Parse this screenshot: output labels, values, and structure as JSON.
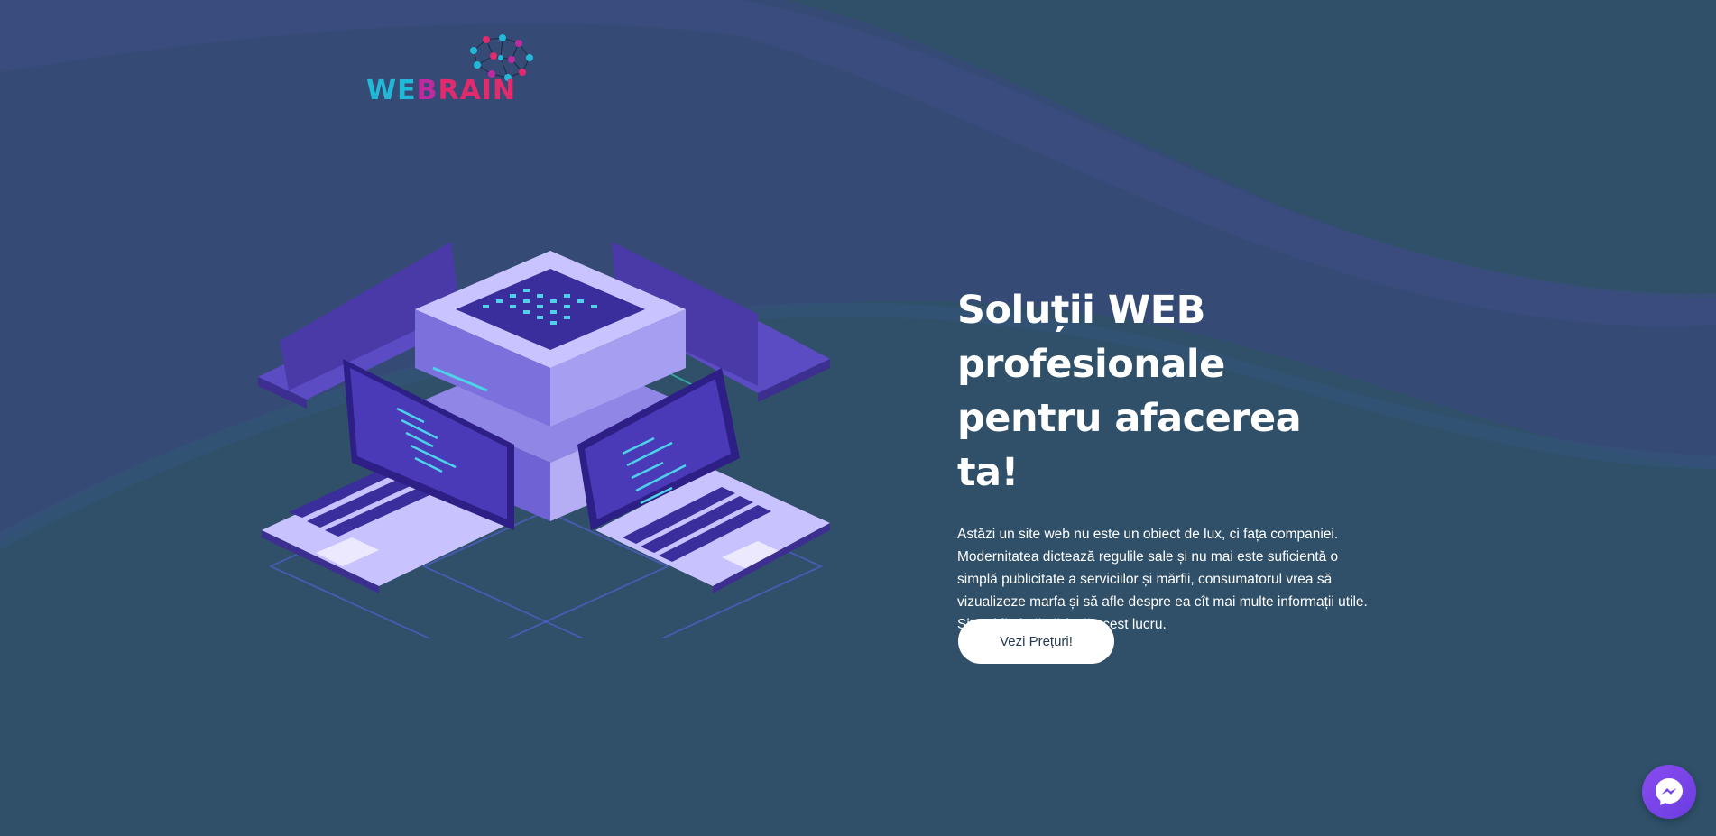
{
  "brand": {
    "logo_text_1": "WE",
    "logo_text_2": "B",
    "logo_text_3": "RAIN",
    "colors": {
      "logo_cyan": "#22b8d8",
      "logo_magenta": "#c02aa0",
      "logo_pink": "#e22a6c",
      "background": "#2f5068",
      "wave": "#3a4a7c"
    }
  },
  "hero": {
    "title": "Soluții WEB profesionale pentru afacerea ta!",
    "description": "Astăzi un site web nu este un obiect de lux, ci fața companiei. Modernitatea dictează regulile sale și nu mai este suficientă o simplă publicitate a serviciilor și mărfii, consumatorul vrea să vizualizeze marfa și să afle despre ea cît mai multe informații utile. Site-ul îl ajută să facă acest lucru.",
    "cta_label": "Vezi Prețuri!"
  },
  "widgets": {
    "chat_icon": "messenger-icon"
  }
}
